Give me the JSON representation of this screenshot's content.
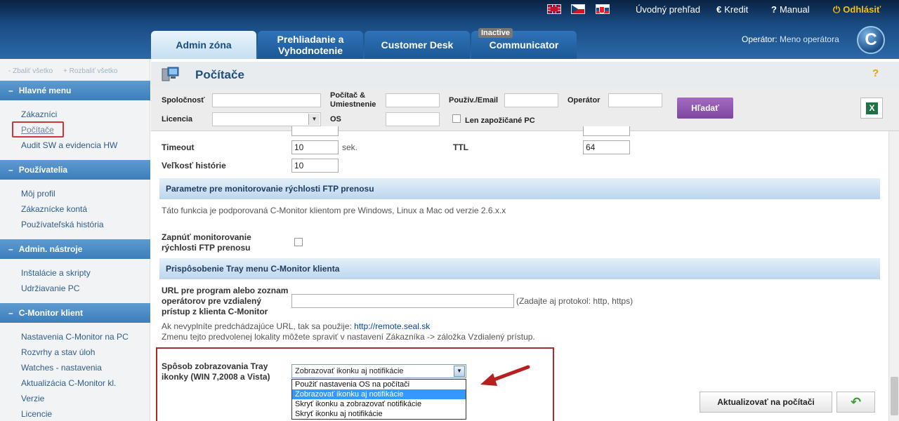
{
  "header": {
    "links": {
      "home": "Úvodný prehľad",
      "credit": "Kredit",
      "manual": "Manual",
      "logout": "Odhlásiť"
    },
    "icons": {
      "credit": "€",
      "manual": "?",
      "logout": "⏻"
    },
    "tabs": {
      "admin": "Admin zóna",
      "prehlad": "Prehliadanie a Vyhodnotenie",
      "desk": "Customer Desk",
      "comm": "Communicator",
      "comm_badge": "Inactive"
    },
    "operator_label": "Operátor:",
    "operator_name": "Meno operátora",
    "logo_letter": "C"
  },
  "sidebar": {
    "collapse_all": "- Zbaliť všetko",
    "expand_all": "+ Rozbaliť všetko",
    "sections": {
      "main": "Hlavné menu",
      "users": "Používatelia",
      "tools": "Admin. nástroje",
      "client": "C-Monitor klient"
    },
    "items": {
      "customers": "Zákazníci",
      "computers": "Počítače",
      "audit": "Audit SW a evidencia HW",
      "profile": "Môj profil",
      "accounts": "Zákaznícke kontá",
      "history": "Používateľská história",
      "installs": "Inštalácie a skripty",
      "maintenance": "Udržiavanie PC",
      "cmon_settings": "Nastavenia C-Monitor na PC",
      "schedules": "Rozvrhy a stav úloh",
      "watches": "Watches - nastavenia",
      "update": "Aktualizácia C-Monitor kl.",
      "versions": "Verzie",
      "licences": "Licencie"
    }
  },
  "page": {
    "title": "Počítače",
    "help": "?"
  },
  "filter": {
    "company": "Spoločnosť",
    "computer": "Počítač & Umiestnenie",
    "user": "Použív./Email",
    "operator": "Operátor",
    "licence": "Licencia",
    "os": "OS",
    "lent": "Len zapožičané PC",
    "search_button": "Hľadať",
    "excel_letter": "X"
  },
  "form": {
    "timeout_label": "Timeout",
    "timeout_value": "10",
    "timeout_unit": "sek.",
    "ttl_label": "TTL",
    "ttl_value": "64",
    "history_label": "Veľkosť histórie",
    "history_value": "10",
    "ftp_section": "Parametre pre monitorovanie rýchlosti FTP prenosu",
    "ftp_note": "Táto funkcia je podporovaná C-Monitor klientom pre Windows, Linux a Mac od verzie 2.6.x.x",
    "ftp_enable_label": "Zapnúť monitorovanie rýchlosti FTP prenosu",
    "tray_section": "Prispôsobenie Tray menu C-Monitor klienta",
    "url_label": "URL pre program alebo zoznam operátorov pre vzdialený prístup z klienta C-Monitor",
    "url_value": "",
    "url_hint": "(Zadajte aj protokol: http, https)",
    "url_note_prefix": "Ak nevyplníte predchádzajúce URL, tak sa použije:",
    "url_note_link": "http://remote.seal.sk",
    "url_note2": "Zmenu tejto predvolenej lokality môžete spraviť v nastavení Zákazníka -> záložka Vzdialený prístup.",
    "tray_label": "Spôsob zobrazovania Tray ikonky (WIN 7,2008 a Vista)",
    "tray_selected": "Zobrazovať ikonku aj notifikácie",
    "tray_options": [
      "Použiť nastavenia OS na počítači",
      "Zobrazovať ikonku aj notifikácie",
      "Skryť ikonku a zobrazovať notifikácie",
      "Skryť ikonku aj notifikácie"
    ],
    "update_button": "Aktualizovať na počítači",
    "back_icon": "↶"
  },
  "colors": {
    "header_blue": "#1b4d85",
    "accent_purple": "#7e469e",
    "highlight_red": "#a82a2a",
    "logout_yellow": "#f5c400"
  }
}
